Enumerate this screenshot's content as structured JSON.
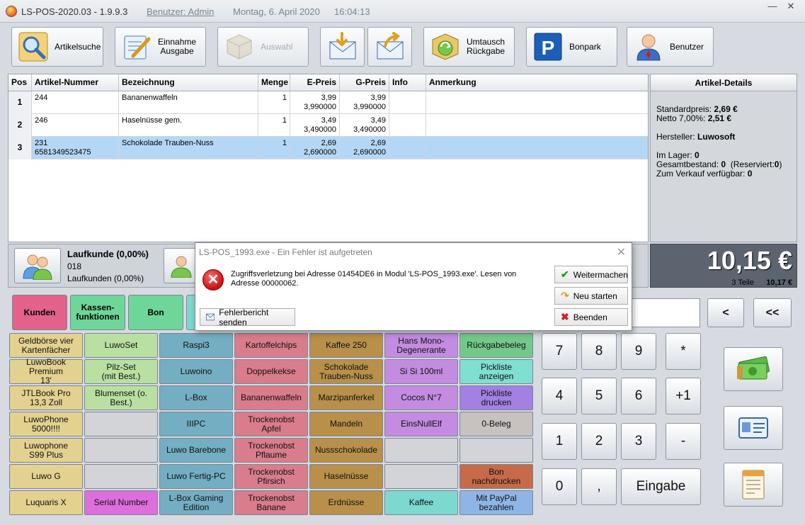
{
  "titlebar": {
    "app": "LS-POS-2020.03",
    "version": "1.9.9.3",
    "user": "Benutzer: Admin",
    "date": "Montag, 6. April 2020",
    "time": "16:04:13",
    "min": "—",
    "close": "✕"
  },
  "toolbar": {
    "artikelsuche": "Artikelsuche",
    "einnahme_l1": "Einnahme",
    "einnahme_l2": "Ausgabe",
    "auswahl": "Auswahl",
    "umtausch_l1": "Umtausch",
    "umtausch_l2": "Rückgabe",
    "bonpark": "Bonpark",
    "benutzer": "Benutzer"
  },
  "grid": {
    "headers": [
      "Pos",
      "Artikel-Nummer",
      "Bezeichnung",
      "Menge",
      "E-Preis",
      "G-Preis",
      "Info",
      "Anmerkung"
    ],
    "rows": [
      {
        "pos": "1",
        "nr1": "244",
        "nr2": "",
        "bez": "Bananenwaffeln",
        "menge": "1",
        "e1": "3,99",
        "e2": "3,990000",
        "g1": "3,99",
        "g2": "3,990000"
      },
      {
        "pos": "2",
        "nr1": "246",
        "nr2": "",
        "bez": "Haselnüsse gem.",
        "menge": "1",
        "e1": "3,49",
        "e2": "3,490000",
        "g1": "3,49",
        "g2": "3,490000"
      },
      {
        "pos": "3",
        "nr1": "231",
        "nr2": "6581349523475",
        "bez": "Schokolade Trauben-Nuss",
        "menge": "1",
        "e1": "2,69",
        "e2": "2,690000",
        "g1": "2,69",
        "g2": "2,690000"
      }
    ]
  },
  "details": {
    "title": "Artikel-Details",
    "std_label": "Standardpreis:",
    "std_val": "2,69 €",
    "netto_label": "Netto 7,00%:",
    "netto_val": "2,51 €",
    "hersteller_label": "Hersteller:",
    "hersteller_val": "Luwosoft",
    "lager_label": "Im Lager:",
    "lager_val": "0",
    "gesamt_label": "Gesamtbestand:",
    "gesamt_val": "0",
    "reserviert_label": "(Reserviert:",
    "reserviert_val": "0",
    "reserviert_end": ")",
    "verkauf_label": "Zum Verkauf verfügbar:",
    "verkauf_val": "0"
  },
  "customer": {
    "name": "Laufkunde (0,00%)",
    "number": "018",
    "group": "Laufkunden (0,00%)"
  },
  "total": {
    "amount": "10,15 €",
    "teile": "3 Teile",
    "sum": "10,17 €"
  },
  "categories": {
    "kunden": "Kunden",
    "kasse_l1": "Kassen-",
    "kasse_l2": "funktionen",
    "bon": "Bon"
  },
  "products": {
    "col1": [
      "Geldbörse vier|Kartenfächer",
      "LuwoBook Premium|13'",
      "JTLBook Pro|13,3 Zoll",
      "LuwoPhone 5000!!!!",
      "Luwophone|S99 Plus",
      "Luwo G",
      "Luquaris X"
    ],
    "col2": [
      "LuwoSet",
      "Pilz-Set|(mit Best.)",
      "Blumenset (o. Best.)",
      "",
      "",
      "",
      "Serial Number"
    ],
    "col3": [
      "Raspi3",
      "Luwoino",
      "L-Box",
      "IIIPC",
      "Luwo Barebone",
      "Luwo Fertig-PC",
      "L-Box Gaming Edition"
    ],
    "col4": [
      "Kartoffelchips",
      "Doppelkekse",
      "Bananenwaffeln",
      "Trockenobst|Apfel",
      "Trockenobst Pflaume",
      "Trockenobst Pfirsich",
      "Trockenobst Banane"
    ],
    "col5": [
      "Kaffee 250",
      "Schokolade|Trauben-Nuss",
      "Marzipanferkel",
      "Mandeln",
      "Nussschokolade",
      "Haselnüsse",
      "Erdnüsse"
    ],
    "col6": [
      "Hans Mono-|Degenerante",
      "Si Si 100ml",
      "Cocos N°7",
      "EinsNullElf",
      "",
      "",
      "Kaffee"
    ],
    "col7": [
      "Rückgabebeleg",
      "Pickliste|anzeigen",
      "Pickliste|drucken",
      "0-Beleg",
      "",
      "Bon|nachdrucken",
      "Mit PayPal|bezahlen"
    ]
  },
  "numpad": {
    "k7": "7",
    "k8": "8",
    "k9": "9",
    "kmul": "*",
    "k4": "4",
    "k5": "5",
    "k6": "6",
    "kplus1": "+1",
    "k1": "1",
    "k2": "2",
    "k3": "3",
    "kminus": "-",
    "k0": "0",
    "kcomma": ",",
    "enter": "Eingabe",
    "back": "<",
    "backall": "<<"
  },
  "dialog": {
    "title": "LS-POS_1993.exe - Ein Fehler ist aufgetreten",
    "message": "Zugriffsverletzung bei Adresse 01454DE6 in Modul 'LS-POS_1993.exe'. Lesen von Adresse 00000062.",
    "report": "Fehlerbericht senden",
    "continue": "Weitermachen",
    "restart": "Neu starten",
    "quit": "Beenden",
    "close": "✕"
  },
  "colors": {
    "selected_row": "#b5d7f6",
    "kunden": "#e3628c",
    "kasse": "#6fd69a",
    "bon": "#6fd69a",
    "total_bg": "#5c6470"
  }
}
